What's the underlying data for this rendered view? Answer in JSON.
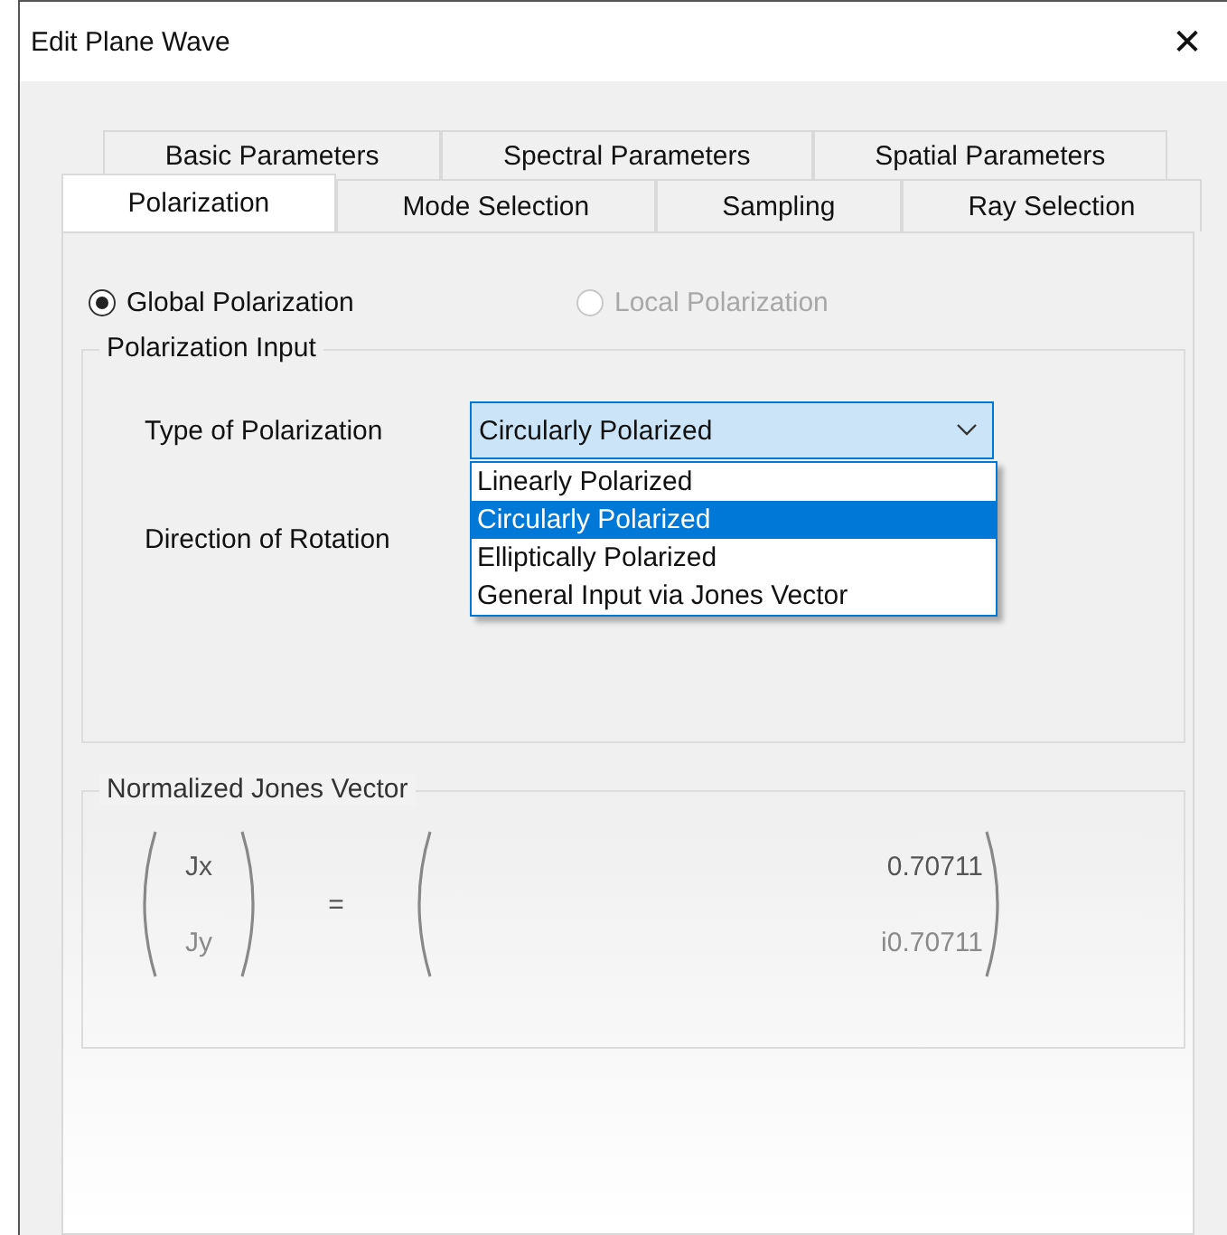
{
  "window": {
    "title": "Edit Plane Wave",
    "close": "✕"
  },
  "tab_rows": [
    {
      "tabs": [
        {
          "label": "Basic Parameters",
          "selected": false
        },
        {
          "label": "Spectral Parameters",
          "selected": false
        },
        {
          "label": "Spatial Parameters",
          "selected": false
        }
      ]
    },
    {
      "tabs": [
        {
          "label": "Polarization",
          "selected": true
        },
        {
          "label": "Mode Selection",
          "selected": false
        },
        {
          "label": "Sampling",
          "selected": false
        },
        {
          "label": "Ray Selection",
          "selected": false
        }
      ]
    }
  ],
  "polarization_mode": [
    {
      "label": "Global Polarization",
      "selected": true,
      "disabled": false
    },
    {
      "label": "Local Polarization",
      "selected": false,
      "disabled": true
    }
  ],
  "polarization_input": {
    "title": "Polarization Input",
    "type_label": "Type of Polarization",
    "type_value": "Circularly Polarized",
    "type_options": [
      {
        "label": "Linearly Polarized",
        "selected": false
      },
      {
        "label": "Circularly Polarized",
        "selected": true
      },
      {
        "label": "Elliptically Polarized",
        "selected": false
      },
      {
        "label": "General Input via Jones Vector",
        "selected": false
      }
    ],
    "rotation_label": "Direction of Rotation"
  },
  "jones_vector": {
    "title": "Normalized Jones Vector",
    "symbols": [
      "Jx",
      "Jy"
    ],
    "equals": "=",
    "values": [
      "0.70711",
      "i0.70711"
    ]
  }
}
